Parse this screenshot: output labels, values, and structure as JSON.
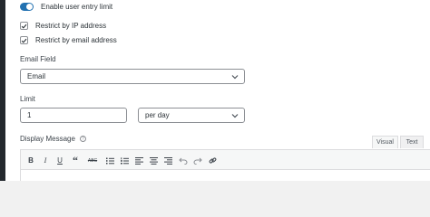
{
  "settings": {
    "enable_limit_label": "Enable user entry limit",
    "restrict_ip_label": "Restrict by IP address",
    "restrict_email_label": "Restrict by email address"
  },
  "email_field": {
    "label": "Email Field",
    "selected": "Email"
  },
  "limit": {
    "label": "Limit",
    "value": "1",
    "period_selected": "per day"
  },
  "display_message": {
    "label": "Display Message",
    "help_glyph": "?",
    "tabs": [
      {
        "label": "Visual"
      },
      {
        "label": "Text"
      }
    ]
  },
  "toolbar": {
    "bold": "B",
    "italic": "I",
    "underline": "U",
    "quote": "“",
    "strikethrough": "ABC"
  },
  "colors": {
    "accent": "#2271b1",
    "admin_bar": "#23282d"
  }
}
